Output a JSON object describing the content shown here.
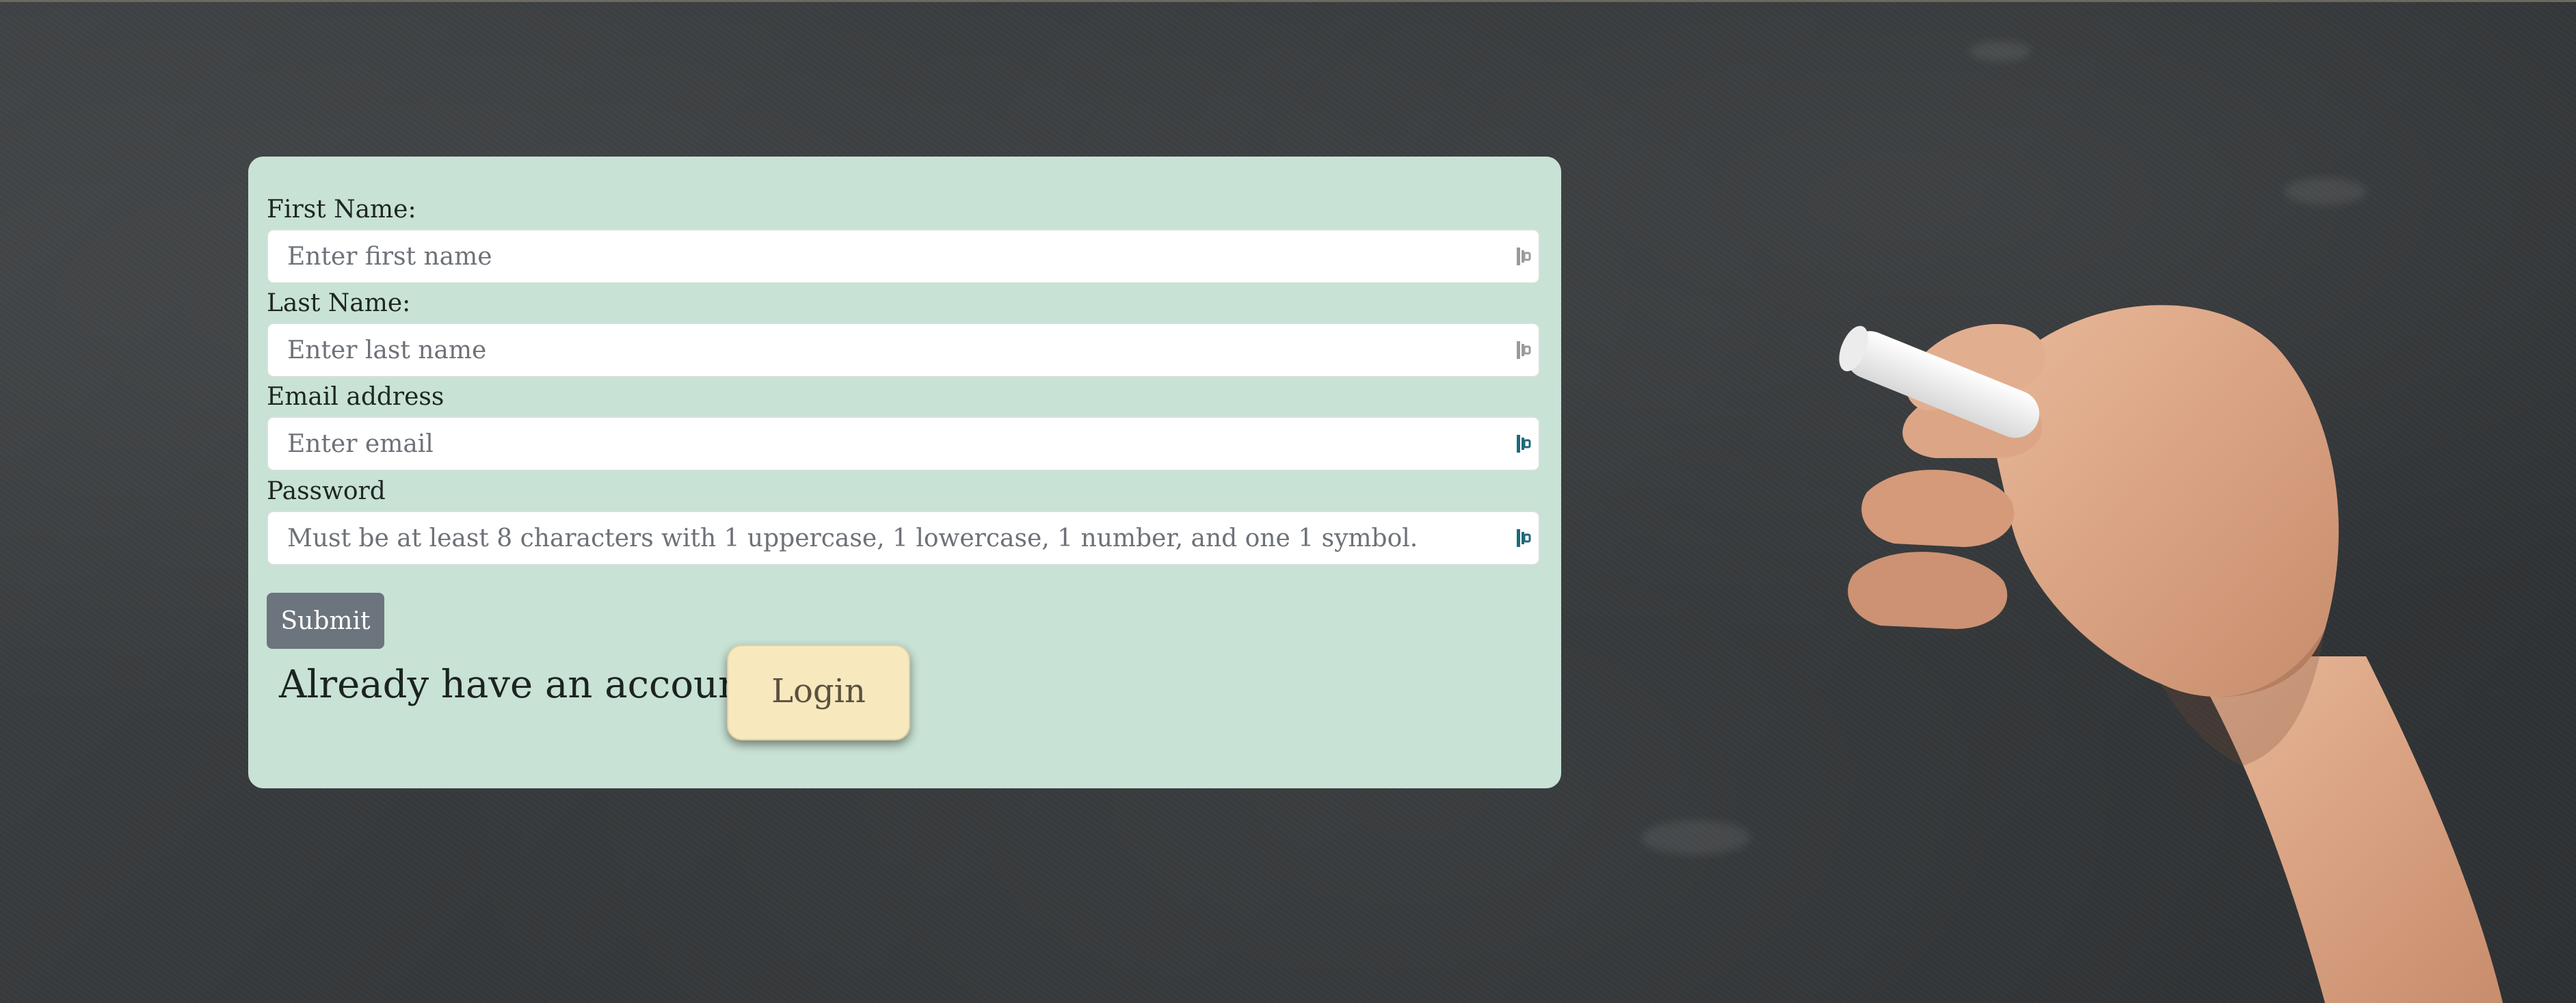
{
  "form": {
    "first_name": {
      "label": "First Name:",
      "placeholder": "Enter first name"
    },
    "last_name": {
      "label": "Last Name:",
      "placeholder": "Enter last name"
    },
    "email": {
      "label": "Email address",
      "placeholder": "Enter email"
    },
    "password": {
      "label": "Password",
      "placeholder": "Must be at least 8 characters with 1 uppercase, 1 lowercase, 1 number, and one 1 symbol."
    },
    "submit_label": "Submit"
  },
  "login_prompt": {
    "text": "Already have an account?",
    "button_label": "Login"
  },
  "icons": {
    "input_key_icon": "password-manager-key-icon",
    "background": "chalkboard-with-hand-holding-chalk"
  },
  "colors": {
    "card_background": "#c8e2d5",
    "submit_background": "#6c757d",
    "login_background": "#f7e8bd",
    "key_icon_gray": "#9a9a9a",
    "key_icon_teal": "#1e6a7a"
  }
}
